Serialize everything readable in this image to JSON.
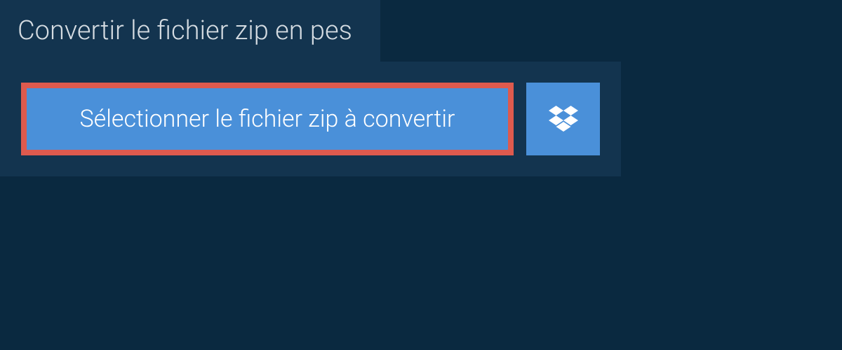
{
  "header": {
    "title": "Convertir le fichier zip en pes"
  },
  "buttons": {
    "select_file_label": "Sélectionner le fichier zip à convertir"
  }
}
